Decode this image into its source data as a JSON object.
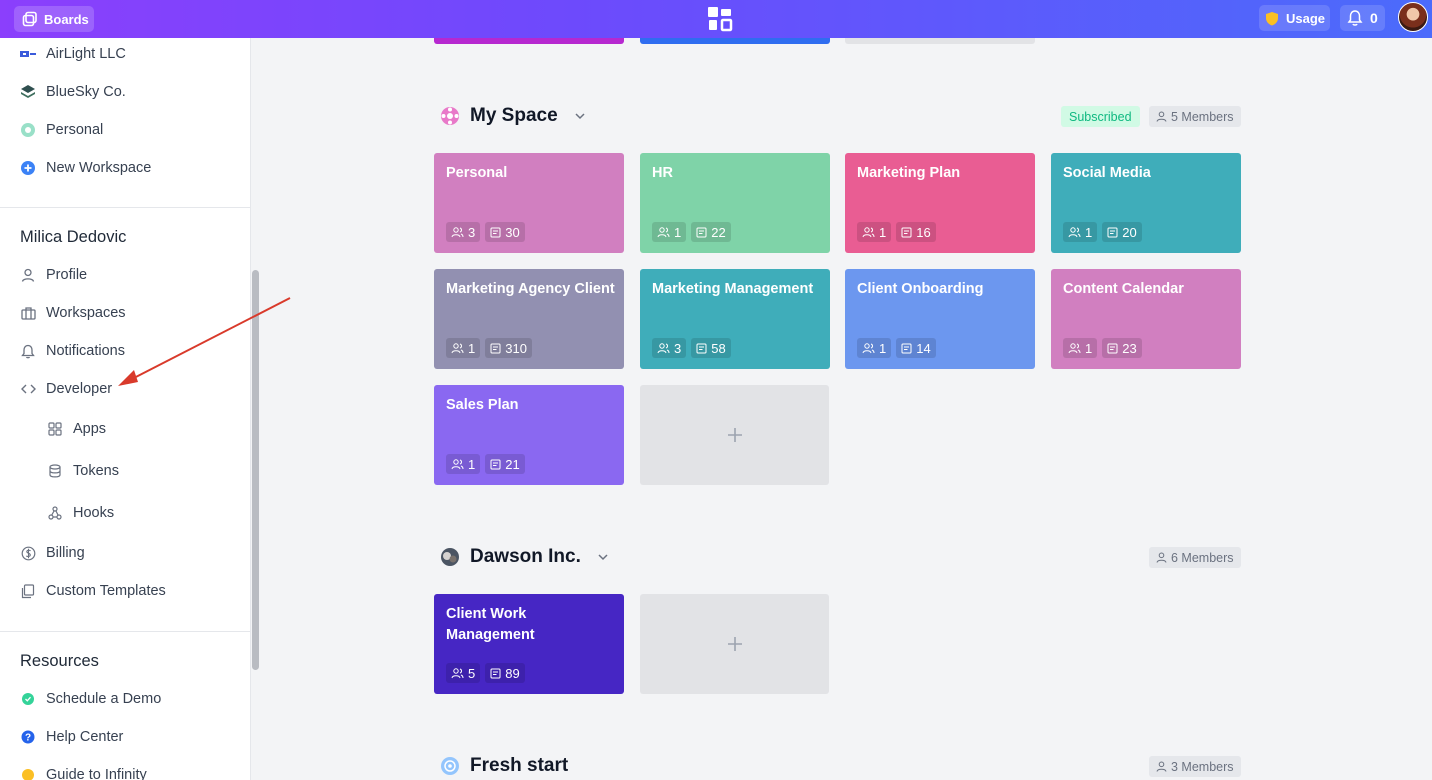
{
  "topbar": {
    "boards_label": "Boards",
    "usage_label": "Usage",
    "notif_count": "0"
  },
  "sidebar": {
    "workspaces": [
      {
        "label": "AirLight LLC",
        "icon": "airlight-logo-icon"
      },
      {
        "label": "BlueSky Co.",
        "icon": "bluesky-logo-icon"
      },
      {
        "label": "Personal",
        "icon": "personal-logo-icon"
      },
      {
        "label": "New Workspace",
        "icon": "plus-circle-icon"
      }
    ],
    "user_name": "Milica Dedovic",
    "user_items": [
      {
        "label": "Profile",
        "icon": "user-icon"
      },
      {
        "label": "Workspaces",
        "icon": "briefcase-icon"
      },
      {
        "label": "Notifications",
        "icon": "bell-icon"
      },
      {
        "label": "Developer",
        "icon": "code-icon"
      }
    ],
    "developer_items": [
      {
        "label": "Apps",
        "icon": "grid-icon"
      },
      {
        "label": "Tokens",
        "icon": "database-icon"
      },
      {
        "label": "Hooks",
        "icon": "webhook-icon"
      }
    ],
    "account_items": [
      {
        "label": "Billing",
        "icon": "dollar-icon"
      },
      {
        "label": "Custom Templates",
        "icon": "template-icon"
      }
    ],
    "resources_heading": "Resources",
    "resource_items": [
      {
        "label": "Schedule a Demo",
        "icon": "green-dot-icon"
      },
      {
        "label": "Help Center",
        "icon": "help-icon"
      },
      {
        "label": "Guide to Infinity",
        "icon": "yellow-dot-icon"
      }
    ]
  },
  "workspaces": [
    {
      "title": "My Space",
      "subscribed_label": "Subscribed",
      "members_label": "5 Members",
      "boards": [
        {
          "title": "Personal",
          "members": "3",
          "items": "30",
          "color": "#d17fc0"
        },
        {
          "title": "HR",
          "members": "1",
          "items": "22",
          "color": "#7fd3a8"
        },
        {
          "title": "Marketing Plan",
          "members": "1",
          "items": "16",
          "color": "#e95d93"
        },
        {
          "title": "Social Media",
          "members": "1",
          "items": "20",
          "color": "#3fadba"
        },
        {
          "title": "Marketing Agency Client",
          "members": "1",
          "items": "310",
          "color": "#9290b1"
        },
        {
          "title": "Marketing Management",
          "members": "3",
          "items": "58",
          "color": "#3fadba"
        },
        {
          "title": "Client Onboarding",
          "members": "1",
          "items": "14",
          "color": "#6c97ef"
        },
        {
          "title": "Content Calendar",
          "members": "1",
          "items": "23",
          "color": "#d17fc0"
        },
        {
          "title": "Sales Plan",
          "members": "1",
          "items": "21",
          "color": "#8a68f1"
        }
      ]
    },
    {
      "title": "Dawson Inc.",
      "members_label": "6 Members",
      "boards": [
        {
          "title": "Client Work Management",
          "members": "5",
          "items": "89",
          "color": "#4626c4"
        }
      ]
    },
    {
      "title": "Fresh start",
      "members_label": "3 Members"
    }
  ]
}
